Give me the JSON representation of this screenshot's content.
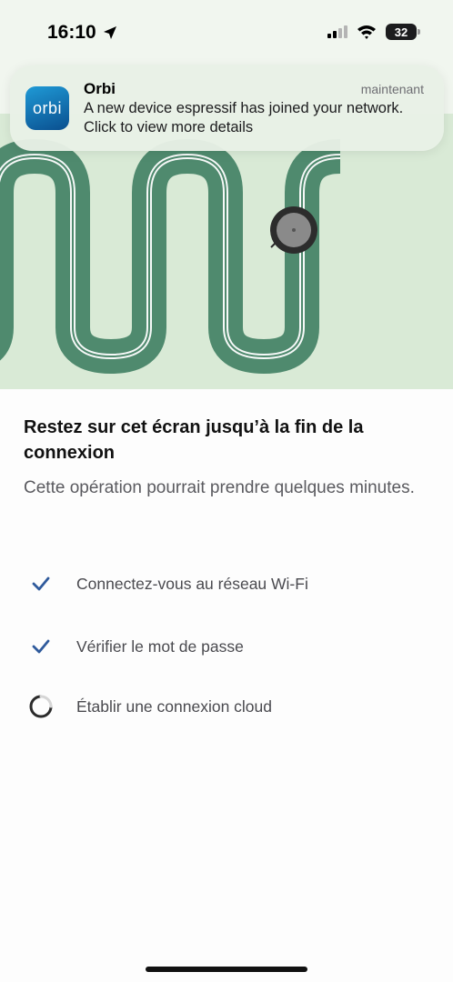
{
  "status_bar": {
    "time": "16:10",
    "battery": "32",
    "icons": [
      "location-arrow-icon",
      "cellular-signal-icon",
      "wifi-icon",
      "battery-icon"
    ]
  },
  "notification": {
    "app_icon_text": "orbi",
    "app_name": "Orbi",
    "time": "maintenant",
    "message": "A new device espressif has joined your network. Click to view more details"
  },
  "content": {
    "title": "Restez sur cet écran jusqu’à la fin de la connexion",
    "subtitle": "Cette opération pourrait prendre quelques minutes.",
    "steps": [
      {
        "label": "Connectez-vous au réseau Wi-Fi",
        "status": "done",
        "icon": "checkmark-icon"
      },
      {
        "label": "Vérifier le mot de passe",
        "status": "done",
        "icon": "checkmark-icon"
      },
      {
        "label": "Établir une connexion cloud",
        "status": "in-progress",
        "icon": "spinner-icon"
      }
    ]
  },
  "colors": {
    "hero_background": "#d9ead6",
    "cable": "#4f8a6e",
    "check": "#2f5a9c",
    "orbi_brand": "#1f9ad6"
  }
}
